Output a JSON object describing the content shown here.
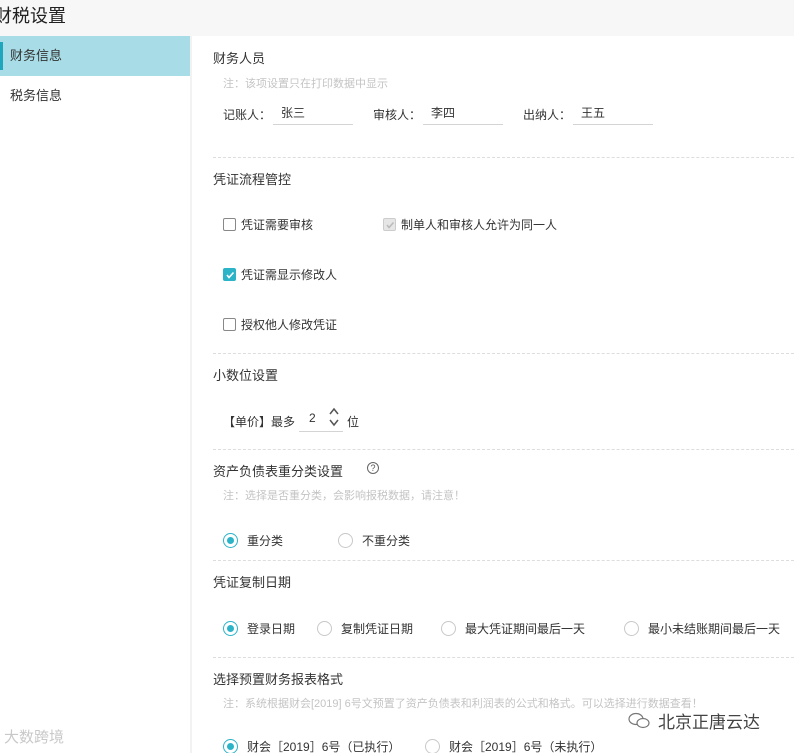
{
  "header": {
    "title": "财税设置"
  },
  "sidebar": {
    "items": [
      {
        "label": "财务信息",
        "active": true
      },
      {
        "label": "税务信息",
        "active": false
      }
    ]
  },
  "finance_staff": {
    "title": "财务人员",
    "note": "注：该项设置只在打印数据中显示",
    "bookkeeper": {
      "label": "记账人：",
      "value": "张三"
    },
    "reviewer": {
      "label": "审核人：",
      "value": "李四"
    },
    "cashier": {
      "label": "出纳人：",
      "value": "王五"
    }
  },
  "voucher_flow": {
    "title": "凭证流程管控",
    "require_review": {
      "label": "凭证需要审核",
      "checked": false
    },
    "same_person": {
      "label": "制单人和审核人允许为同一人",
      "checked": true,
      "disabled": true
    },
    "show_modifier": {
      "label": "凭证需显示修改人",
      "checked": true
    },
    "authorize_edit": {
      "label": "授权他人修改凭证",
      "checked": false
    }
  },
  "decimal": {
    "title": "小数位设置",
    "prefix": "【单价】最多",
    "value": "2",
    "suffix": "位"
  },
  "reclass": {
    "title": "资产负债表重分类设置",
    "help": "?",
    "note": "注：选择是否重分类，会影响报税数据，请注意！",
    "options": [
      {
        "label": "重分类",
        "selected": true
      },
      {
        "label": "不重分类",
        "selected": false
      }
    ]
  },
  "copy_date": {
    "title": "凭证复制日期",
    "options": [
      {
        "label": "登录日期",
        "selected": true
      },
      {
        "label": "复制凭证日期",
        "selected": false
      },
      {
        "label": "最大凭证期间最后一天",
        "selected": false
      },
      {
        "label": "最小未结账期间最后一天",
        "selected": false
      }
    ]
  },
  "report_format": {
    "title": "选择预置财务报表格式",
    "note": "注：系统根据财会[2019] 6号文预置了资产负债表和利润表的公式和格式。可以选择进行数据查看！",
    "options": [
      {
        "label": "财会［2019］6号（已执行）",
        "selected": true
      },
      {
        "label": "财会［2019］6号（未执行）",
        "selected": false
      }
    ]
  },
  "watermark": {
    "left": "大数跨境",
    "right": "北京正唐云达"
  },
  "colors": {
    "accent": "#2bb3c8",
    "active_bg": "#a8dde7"
  }
}
